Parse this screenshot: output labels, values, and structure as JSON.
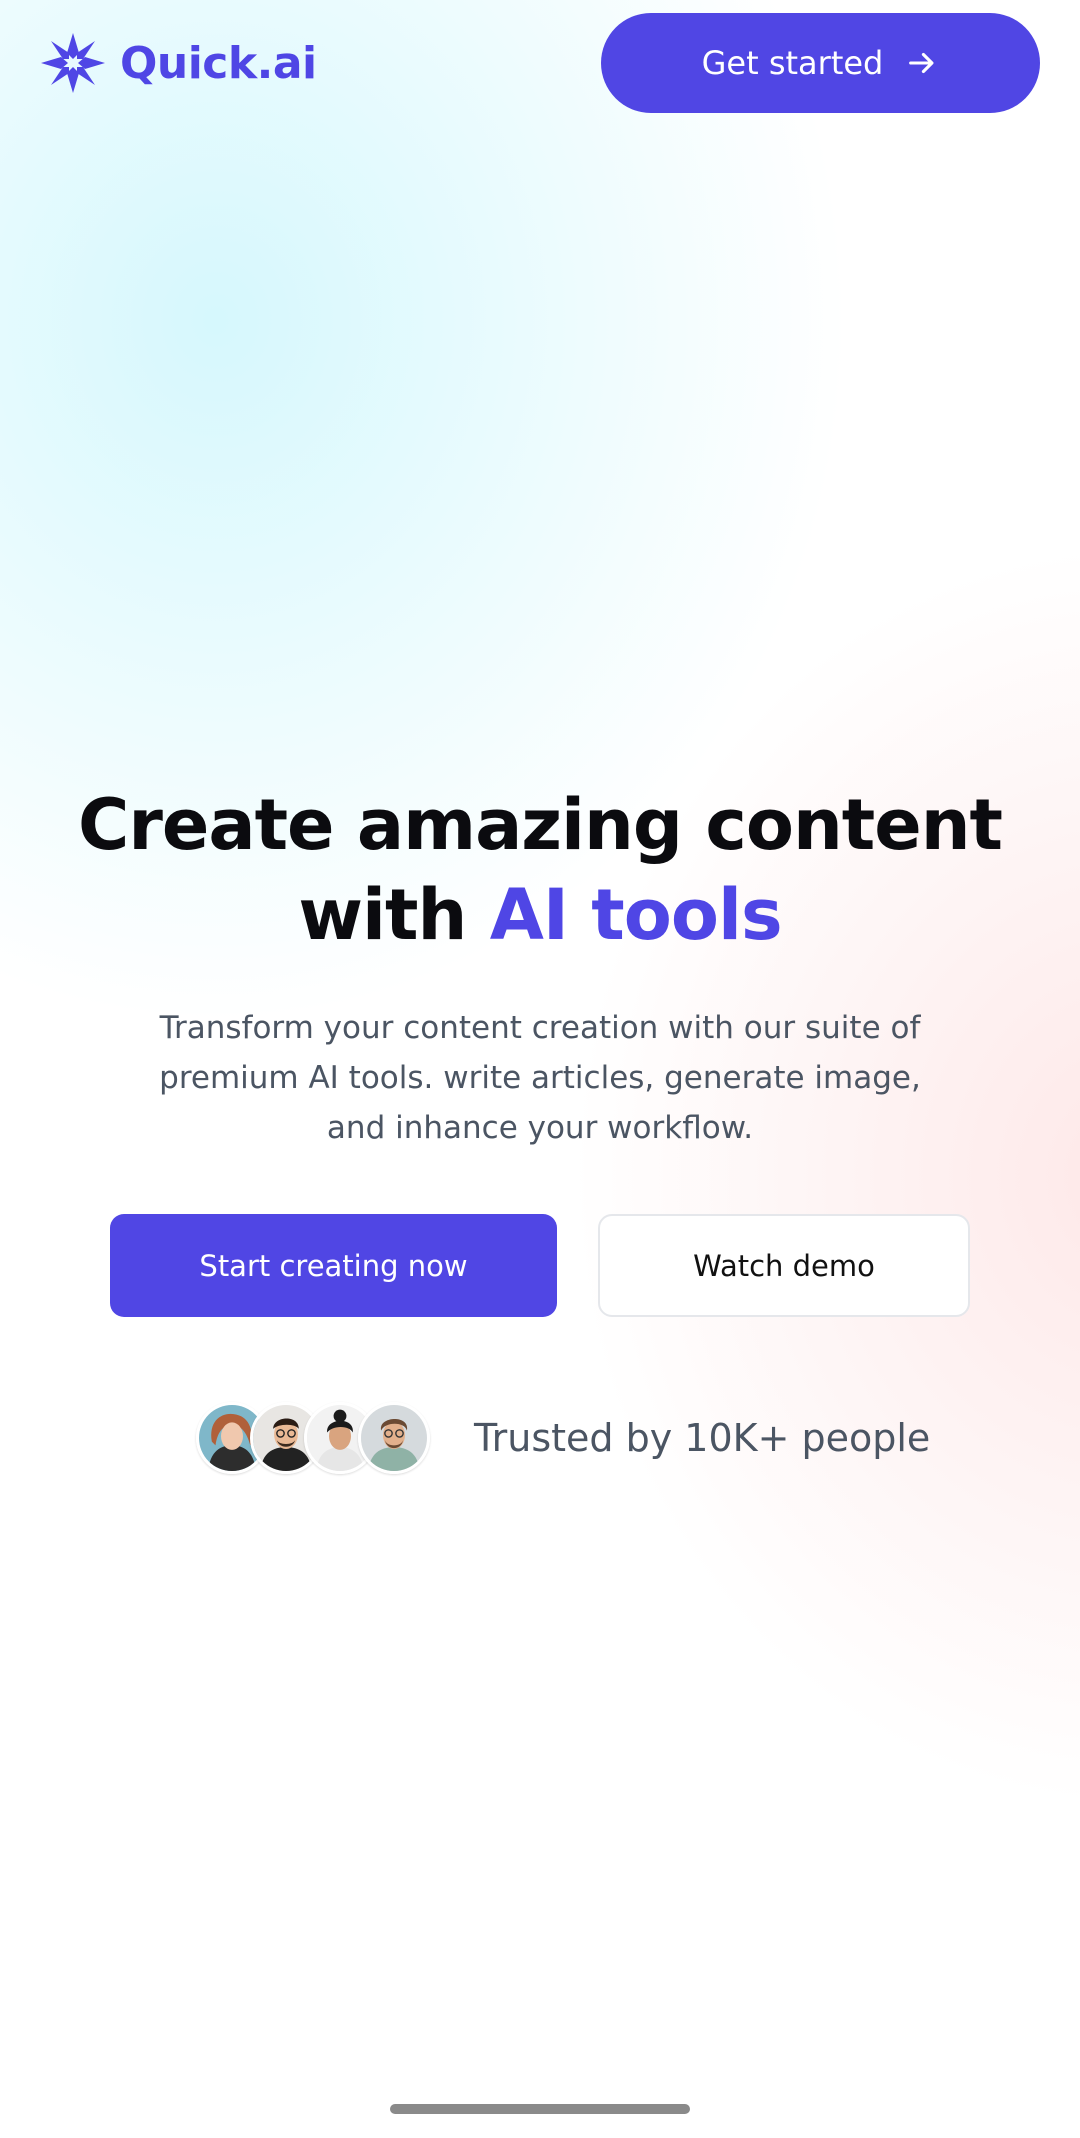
{
  "brand": {
    "name": "Quick.ai",
    "color": "#4f46e5",
    "logo_icon": "sparkle-star-icon"
  },
  "header": {
    "cta_label": "Get started",
    "cta_icon": "arrow-right-icon"
  },
  "hero": {
    "title_main": "Create amazing content with",
    "title_accent": "AI tools",
    "subtitle": "Transform your content creation with our suite of premium AI tools. write articles, generate image, and inhance your workflow."
  },
  "actions": {
    "primary_label": "Start creating now",
    "secondary_label": "Watch demo"
  },
  "social_proof": {
    "avatars": [
      "user-avatar-1",
      "user-avatar-2",
      "user-avatar-3",
      "user-avatar-4"
    ],
    "text": "Trusted by 10K+ people"
  },
  "colors": {
    "primary": "#5046e4",
    "text_dark": "#0b0b0f",
    "text_muted": "#4b5563"
  }
}
